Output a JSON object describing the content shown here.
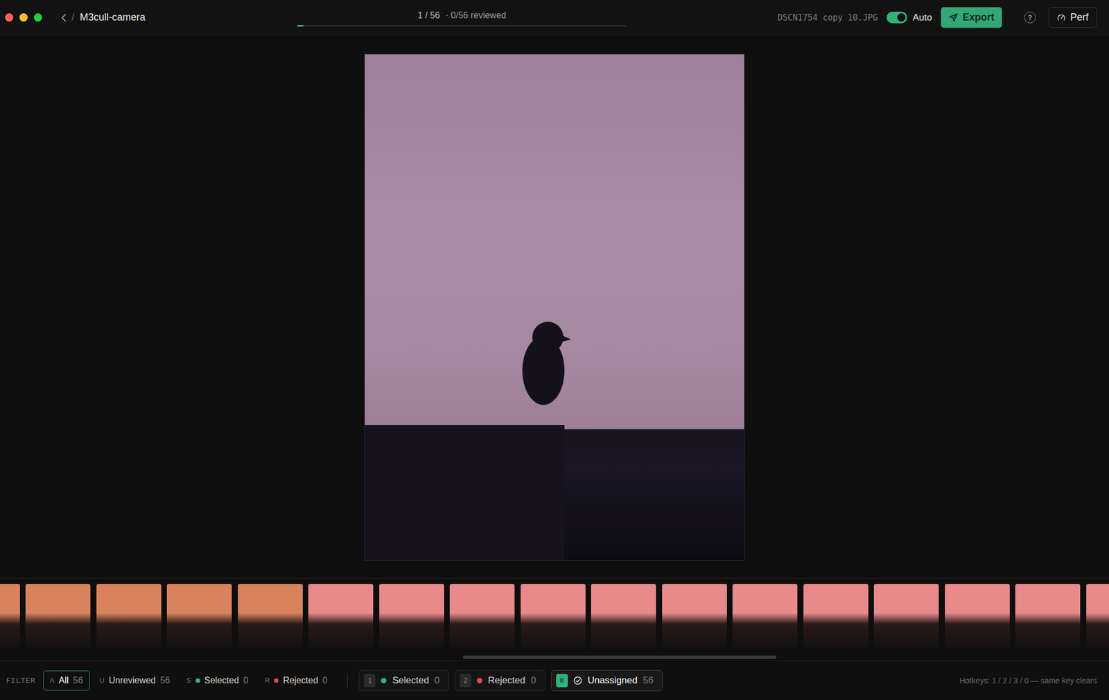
{
  "window": {
    "title": "M3cull-camera",
    "separator": "/"
  },
  "progress": {
    "position": "1 / 56",
    "reviewed": "· 0/56 reviewed",
    "level": 0.018
  },
  "filename": "DSCN1754 copy 10.JPG",
  "auto": {
    "label": "Auto",
    "on": true
  },
  "export": "Export",
  "help": "?",
  "perf": "Perf",
  "filmstrip": {
    "thumbnails": [
      {
        "color": "#d9835e"
      },
      {
        "color": "#d9835e"
      },
      {
        "color": "#d9835e"
      },
      {
        "color": "#d9835e"
      },
      {
        "color": "#d9835e"
      },
      {
        "color": "#e8898a"
      },
      {
        "color": "#e8898a"
      },
      {
        "color": "#e8898a"
      },
      {
        "color": "#e8898a"
      },
      {
        "color": "#e8898a"
      },
      {
        "color": "#e8898a"
      },
      {
        "color": "#e8898a"
      },
      {
        "color": "#e8898a"
      },
      {
        "color": "#e8898a"
      },
      {
        "color": "#e8898a"
      },
      {
        "color": "#e8898a"
      },
      {
        "color": "#e8898a"
      }
    ],
    "scrollbar": {
      "level": 0.283
    }
  },
  "filters": {
    "label": "FILTER",
    "items": [
      {
        "key": "A",
        "label": "All",
        "count": "56",
        "selected": true
      },
      {
        "key": "U",
        "label": "Unreviewed",
        "count": "56",
        "selected": false
      },
      {
        "key": "S",
        "label": "Selected",
        "count": "0",
        "selected": false,
        "color": "#2fb37a"
      },
      {
        "key": "R",
        "label": "Rejected",
        "count": "0",
        "selected": false,
        "color": "#e5484d"
      }
    ]
  },
  "assign": {
    "items": [
      {
        "key": "1",
        "label": "Selected",
        "count": "0",
        "selected": false,
        "kind": "dot",
        "color": "#2fb37a"
      },
      {
        "key": "2",
        "label": "Rejected",
        "count": "0",
        "selected": false,
        "kind": "dot",
        "color": "#e5484d"
      },
      {
        "key": "0",
        "label": "Unassigned",
        "count": "56",
        "selected": true,
        "kind": "check"
      }
    ]
  },
  "hotkeys": "Hotkeys: 1 / 2 / 3 / 0 — same key clears"
}
